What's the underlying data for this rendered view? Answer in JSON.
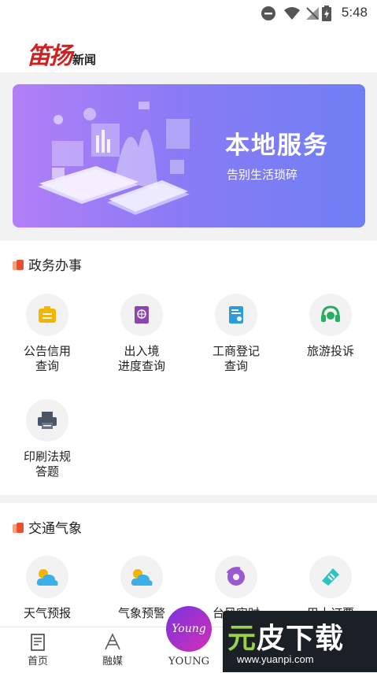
{
  "status": {
    "time": "5:48"
  },
  "header": {
    "logo_main": "笛扬",
    "logo_sub": "新闻"
  },
  "banner": {
    "title": "本地服务",
    "subtitle": "告别生活琐碎"
  },
  "gov_section": {
    "title": "政务办事",
    "items": [
      {
        "label": "公告信用\n查询",
        "icon": "announcement-icon",
        "color": "#f4b400"
      },
      {
        "label": "出入境\n进度查询",
        "icon": "passport-icon",
        "color": "#8e44ad"
      },
      {
        "label": "工商登记\n查询",
        "icon": "id-card-icon",
        "color": "#2d9cdb"
      },
      {
        "label": "旅游投诉",
        "icon": "headset-icon",
        "color": "#27ae60"
      },
      {
        "label": "印刷法规\n答题",
        "icon": "printer-icon",
        "color": "#4a5566"
      }
    ]
  },
  "traffic_section": {
    "title": "交通气象",
    "items": [
      {
        "label": "天气预报",
        "icon": "weather-icon",
        "color": "#3ab0e6"
      },
      {
        "label": "气象预警",
        "icon": "weather-warning-icon",
        "color": "#3ab0e6"
      },
      {
        "label": "台风实时",
        "icon": "typhoon-icon",
        "color": "#9b59d0"
      },
      {
        "label": "巴士订票",
        "icon": "ticket-icon",
        "color": "#2bc4c4"
      }
    ]
  },
  "tabbar": {
    "items": [
      {
        "label": "首页",
        "icon": "newspaper-icon"
      },
      {
        "label": "融媒",
        "icon": "media-icon"
      },
      {
        "label": "YOUNG",
        "icon": "young-icon"
      }
    ],
    "young_badge": "Young"
  },
  "watermark": {
    "brand_green": "元",
    "brand_rest": "皮下载",
    "url": "www.yuanpi.com"
  }
}
